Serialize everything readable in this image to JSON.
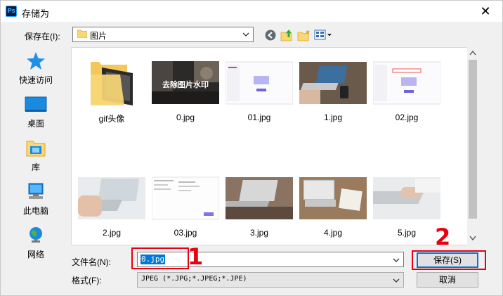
{
  "window": {
    "title": "存储为",
    "app_icon_text": "Ps",
    "close_glyph": "✕"
  },
  "toolbar": {
    "save_in_label": "保存在(I):",
    "location": "图片",
    "icons": [
      "back-icon",
      "up-folder-icon",
      "new-folder-icon",
      "view-menu-icon"
    ]
  },
  "sidebar": {
    "items": [
      {
        "label": "快速访问",
        "icon": "star-icon"
      },
      {
        "label": "桌面",
        "icon": "desktop-icon"
      },
      {
        "label": "库",
        "icon": "library-icon"
      },
      {
        "label": "此电脑",
        "icon": "computer-icon"
      },
      {
        "label": "网络",
        "icon": "network-icon"
      }
    ]
  },
  "files": [
    {
      "name": "gif头像",
      "kind": "folder"
    },
    {
      "name": "0.jpg",
      "kind": "image",
      "overlay_text": "去除图片水印"
    },
    {
      "name": "01.jpg",
      "kind": "image"
    },
    {
      "name": "1.jpg",
      "kind": "image"
    },
    {
      "name": "02.jpg",
      "kind": "image"
    },
    {
      "name": "2.jpg",
      "kind": "image"
    },
    {
      "name": "03.jpg",
      "kind": "image"
    },
    {
      "name": "3.jpg",
      "kind": "image"
    },
    {
      "name": "4.jpg",
      "kind": "image"
    },
    {
      "name": "5.jpg",
      "kind": "image"
    }
  ],
  "form": {
    "filename_label": "文件名(N):",
    "filename_value": "0.jpg",
    "format_label": "格式(F):",
    "format_value": "JPEG (*.JPG;*.JPEG;*.JPE)",
    "save_button": "保存(S)",
    "cancel_button": "取消"
  },
  "annotations": {
    "step1": "1",
    "step2": "2"
  },
  "colors": {
    "accent": "#0078d7",
    "annotation": "#e60012",
    "folder": "#f8d775"
  }
}
